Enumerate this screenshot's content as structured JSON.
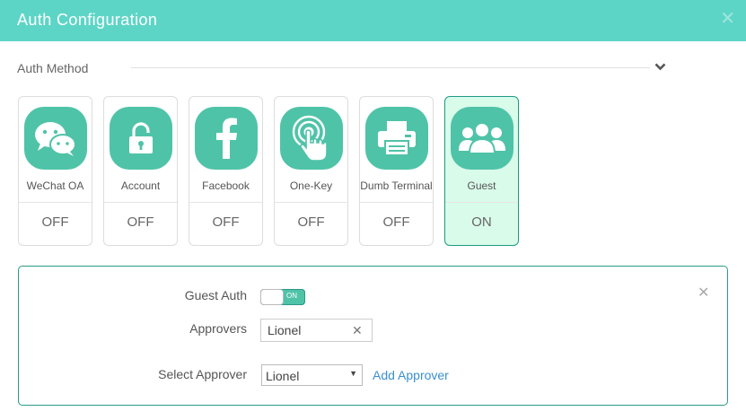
{
  "dialog": {
    "title": "Auth Configuration"
  },
  "auth_method": {
    "label": "Auth Method"
  },
  "methods": [
    {
      "label": "WeChat OA",
      "state": "OFF",
      "icon": "wechat-icon"
    },
    {
      "label": "Account",
      "state": "OFF",
      "icon": "lock-icon"
    },
    {
      "label": "Facebook",
      "state": "OFF",
      "icon": "facebook-icon"
    },
    {
      "label": "One-Key",
      "state": "OFF",
      "icon": "tap-icon"
    },
    {
      "label": "Dumb Terminal",
      "state": "OFF",
      "icon": "printer-icon"
    },
    {
      "label": "Guest",
      "state": "ON",
      "icon": "users-icon"
    }
  ],
  "guest_panel": {
    "guest_auth_label": "Guest Auth",
    "toggle_on_text": "ON",
    "approvers_label": "Approvers",
    "approver_tag": "Lionel",
    "select_approver_label": "Select Approver",
    "selected_approver": "Lionel",
    "add_approver": "Add Approver"
  },
  "colors": {
    "header": "#5dd5c6",
    "icon_bg": "#4fc3a8",
    "active_card_bg": "#d9fbea",
    "link": "#3a8fd0"
  }
}
